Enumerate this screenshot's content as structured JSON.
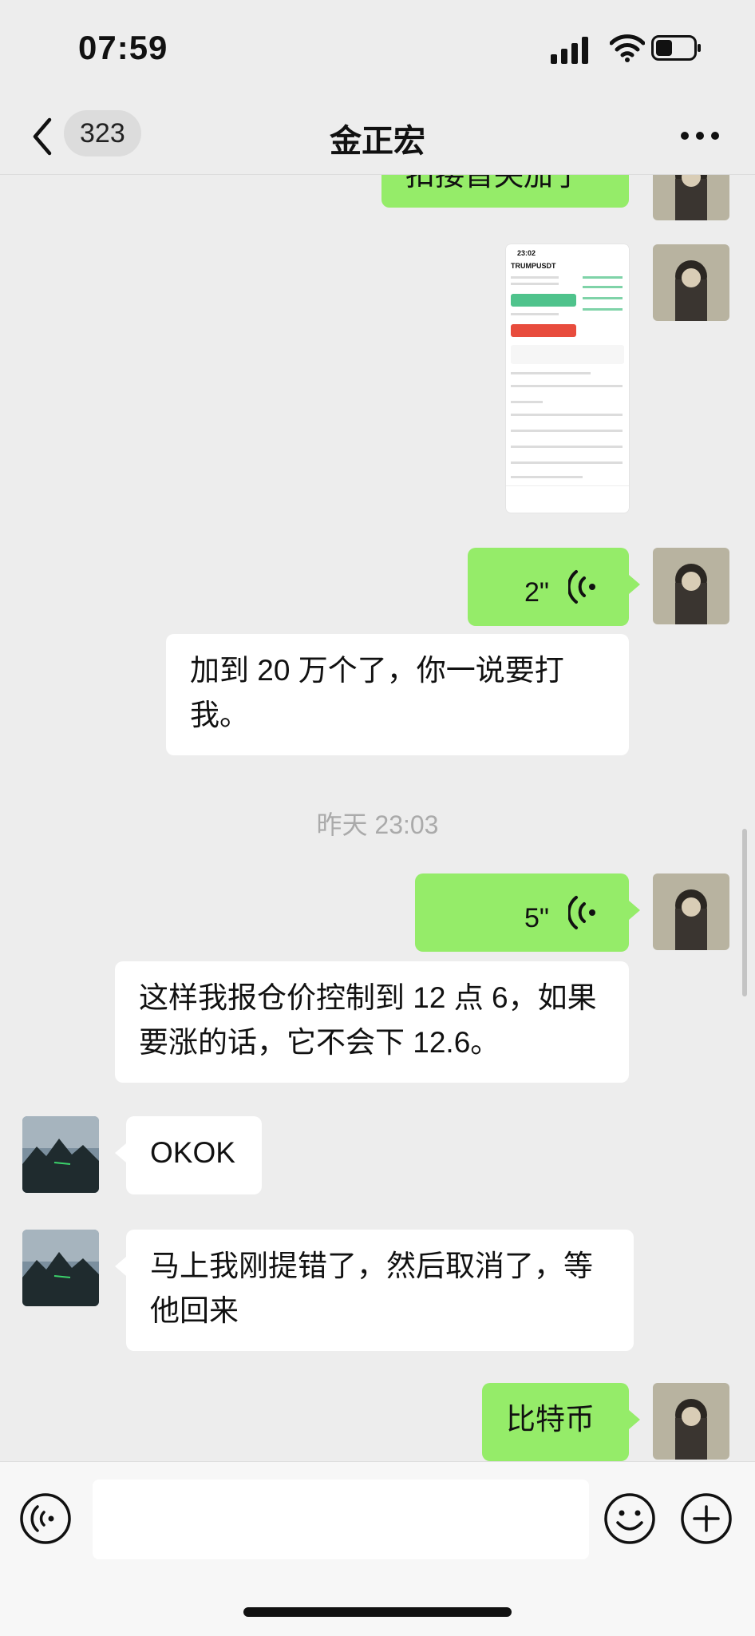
{
  "status_bar": {
    "time": "07:59"
  },
  "header": {
    "back_count": "323",
    "title": "金正宏"
  },
  "messages": {
    "m0_partial": "扣接首央加了",
    "image_preview": {
      "time": "23:02",
      "symbol": "TRUMPUSDT"
    },
    "voice1": "2\"",
    "text1": "加到 20 万个了，你一说要打我。",
    "timestamp": "昨天 23:03",
    "voice2": "5\"",
    "text2": "这样我报仓价控制到 12 点 6，如果要涨的话，它不会下 12.6。",
    "text3": "OKOK",
    "text4": "马上我刚提错了，然后取消了，等他回来",
    "text5": "比特币"
  },
  "colors": {
    "sent_bubble": "#95ec69",
    "received_bubble": "#ffffff",
    "background": "#ededed"
  }
}
